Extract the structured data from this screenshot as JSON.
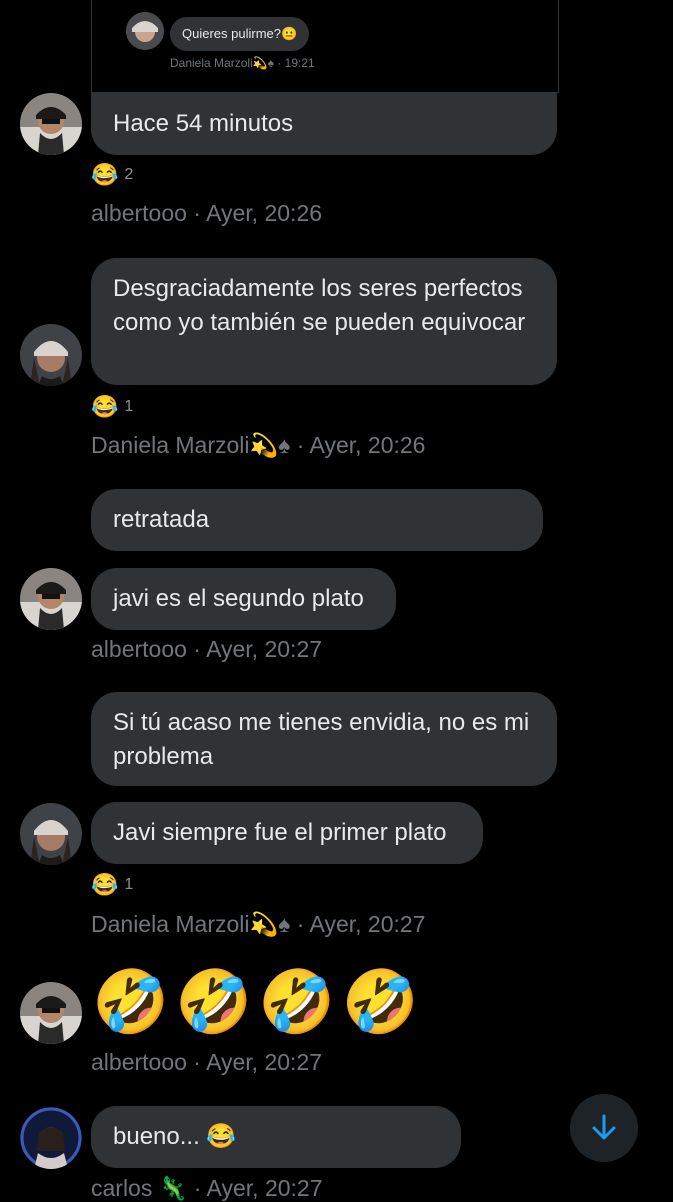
{
  "quoted": {
    "text": "Quieres pulirme?😐",
    "meta": "Daniela Marzoli💫♠ · 19:21"
  },
  "messages": [
    {
      "text": "Hace 54 minutos"
    },
    {
      "text": "Desgraciadamente los seres perfectos como yo también se pueden equivocar"
    },
    {
      "text": "retratada"
    },
    {
      "text": "javi es el segundo plato"
    },
    {
      "text": "Si tú acaso me tienes envidia, no es mi problema"
    },
    {
      "text": "Javi siempre fue el primer plato"
    },
    {
      "text": "🤣🤣🤣🤣"
    },
    {
      "text": "bueno... 😂"
    }
  ],
  "reactions": [
    {
      "emoji": "😂",
      "count": "2"
    },
    {
      "emoji": "😂",
      "count": "1"
    },
    {
      "emoji": "😂",
      "count": "1"
    }
  ],
  "metas": [
    "albertooo · Ayer, 20:26",
    "Daniela Marzoli💫♠ · Ayer, 20:26",
    "albertooo · Ayer, 20:27",
    "Daniela Marzoli💫♠ · Ayer, 20:27",
    "albertooo · Ayer, 20:27",
    "carlos 🦎 · Ayer, 20:27"
  ],
  "colors": {
    "background": "#000000",
    "bubble": "#2f3336",
    "text": "#e7e9ea",
    "muted": "#71767b",
    "accent": "#1d9bf0"
  },
  "icons": {
    "scroll_down": "arrow-down-icon"
  }
}
